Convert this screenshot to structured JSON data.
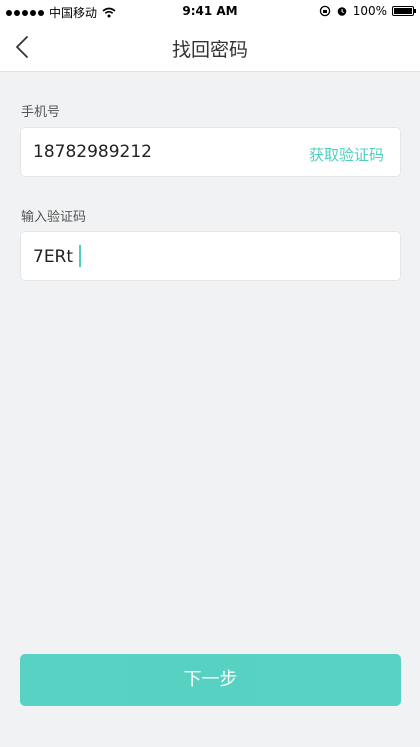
{
  "status_bar": {
    "carrier": "中国移动",
    "time": "9:41 AM",
    "battery": "100%",
    "battery_level": 1.0
  },
  "nav": {
    "title": "找回密码",
    "back_icon": "chevron-left-icon"
  },
  "phone": {
    "label": "手机号",
    "value": "18782989212",
    "get_code_label": "获取验证码"
  },
  "code": {
    "label": "输入验证码",
    "value": "7ERt"
  },
  "next_button": {
    "label": "下一步"
  },
  "colors": {
    "accent": "#4fd0bf",
    "background": "#f1f2f3"
  }
}
